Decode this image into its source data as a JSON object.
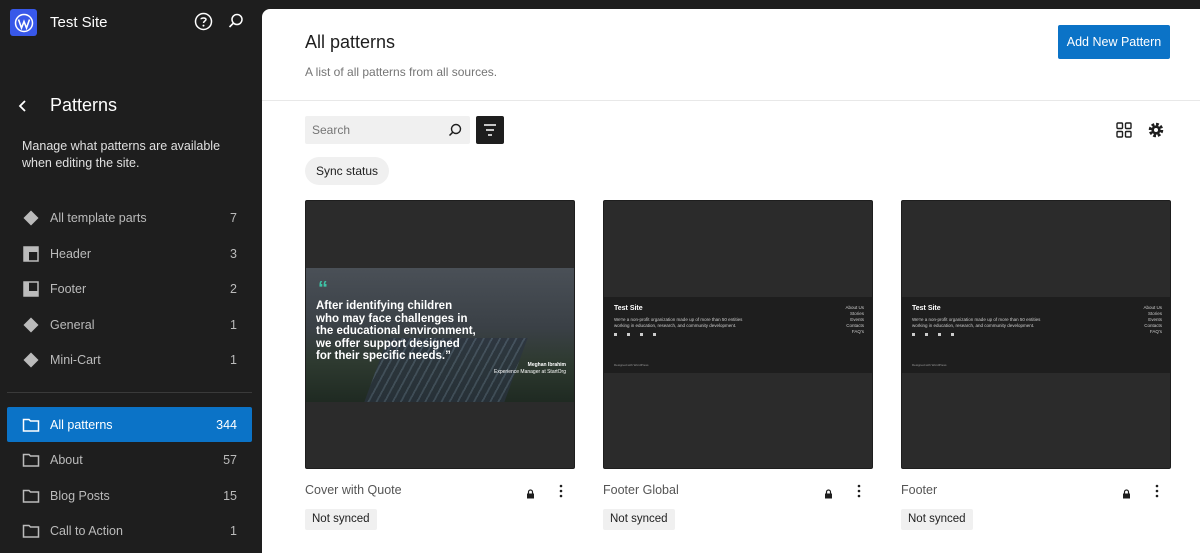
{
  "site": {
    "title": "Test Site"
  },
  "sidebar": {
    "title": "Patterns",
    "description": "Manage what patterns are available when editing the site.",
    "template_parts": [
      {
        "label": "All template parts",
        "count": "7",
        "icon": "template-part-icon"
      },
      {
        "label": "Header",
        "count": "3",
        "icon": "header-icon"
      },
      {
        "label": "Footer",
        "count": "2",
        "icon": "footer-icon"
      },
      {
        "label": "General",
        "count": "1",
        "icon": "template-part-icon"
      },
      {
        "label": "Mini-Cart",
        "count": "1",
        "icon": "template-part-icon"
      }
    ],
    "categories": [
      {
        "label": "All patterns",
        "count": "344",
        "active": true
      },
      {
        "label": "About",
        "count": "57"
      },
      {
        "label": "Blog Posts",
        "count": "15"
      },
      {
        "label": "Call to Action",
        "count": "1"
      }
    ]
  },
  "main": {
    "title": "All patterns",
    "description": "A list of all patterns from all sources.",
    "add_button": "Add New Pattern",
    "search_placeholder": "Search",
    "filter_chip": "Sync status",
    "cards": [
      {
        "name": "Cover with Quote",
        "badge": "Not synced",
        "preview": {
          "quote_mark": "“",
          "quote": "After identifying children who may face challenges in the educational environment, we offer support designed for their specific needs.”",
          "author": "Meghan Ibrahim",
          "author_role": "Experience Manager at StartOrg"
        }
      },
      {
        "name": "Footer Global",
        "badge": "Not synced",
        "preview": {
          "title": "Test Site",
          "desc": "We're a non-profit organization made up of more than 50 entities working in education, research, and community development.",
          "links": [
            "About Us",
            "Stories",
            "Events",
            "Contacts",
            "FAQ's"
          ],
          "copyright": "Designed with WordPress"
        }
      },
      {
        "name": "Footer",
        "badge": "Not synced",
        "preview": {
          "title": "Test Site",
          "desc": "We're a non-profit organization made up of more than 50 entities working in education, research, and community development.",
          "links": [
            "About Us",
            "Stories",
            "Events",
            "Contacts",
            "FAQ's"
          ],
          "copyright": "Designed with WordPress"
        }
      }
    ]
  },
  "colors": {
    "accent": "#0b73c7",
    "sidebar_bg": "#1e1e1e",
    "brand": "#3858e9"
  }
}
